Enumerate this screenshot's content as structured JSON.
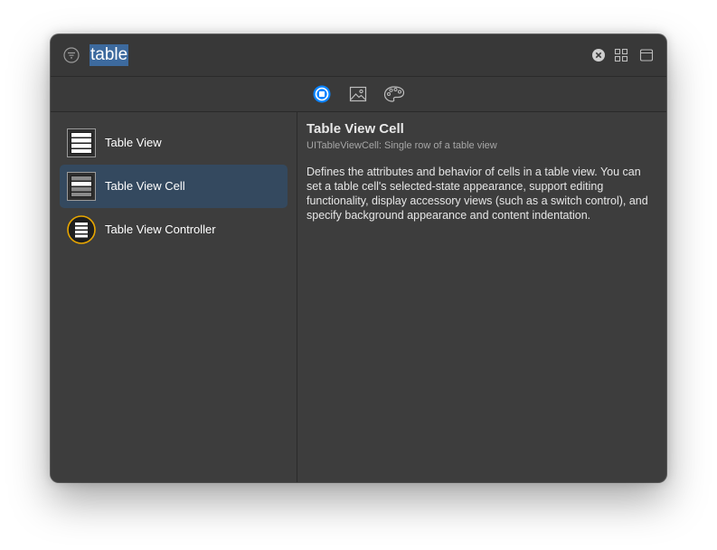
{
  "search": {
    "query": "table"
  },
  "library_tabs": [
    {
      "icon": "objects-icon",
      "selected": true
    },
    {
      "icon": "image-icon",
      "selected": false
    },
    {
      "icon": "palette-icon",
      "selected": false
    }
  ],
  "results": [
    {
      "label": "Table View",
      "icon": "table-view-icon",
      "selected": false
    },
    {
      "label": "Table View Cell",
      "icon": "table-view-cell-icon",
      "selected": true
    },
    {
      "label": "Table View Controller",
      "icon": "table-view-controller-icon",
      "selected": false
    }
  ],
  "detail": {
    "title": "Table View Cell",
    "subtitle": "UITableViewCell: Single row of a table view",
    "description": "Defines the attributes and behavior of cells in a table view. You can set a table cell's selected-state appearance, support editing functionality, display accessory views (such as a switch control), and specify background appearance and content indentation."
  },
  "colors": {
    "accent": "#0a84ff",
    "selection": "#34495f",
    "controller_ring": "#e8a600"
  }
}
